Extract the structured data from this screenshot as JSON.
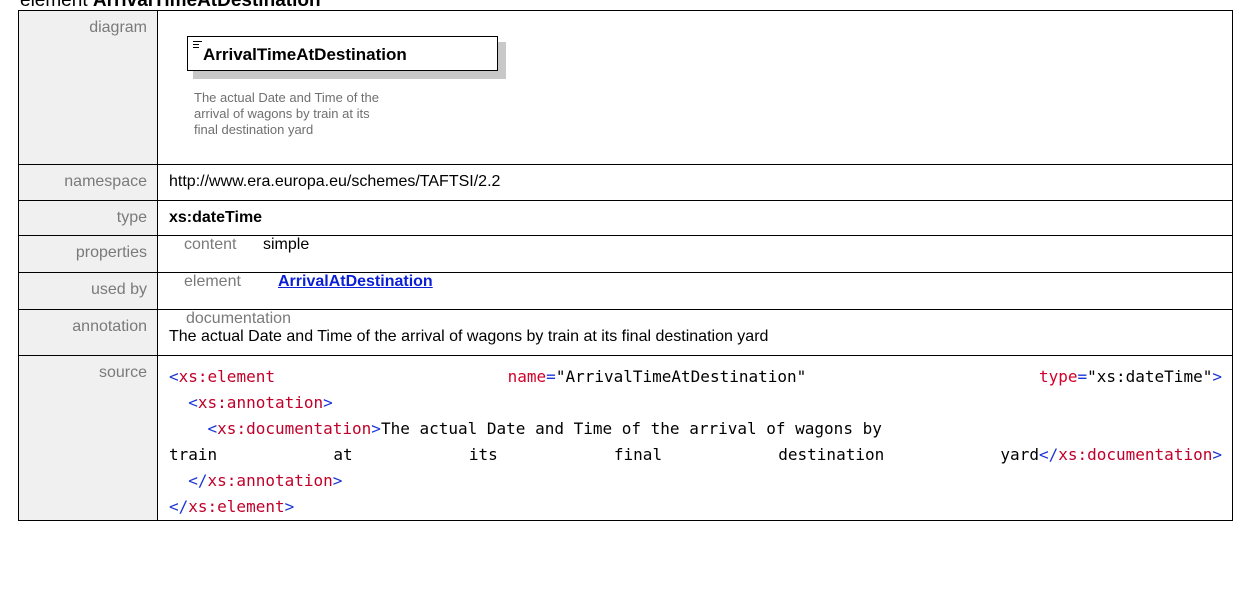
{
  "heading": {
    "prefix": "element ",
    "name": "ArrivalTimeAtDestination"
  },
  "labels": {
    "diagram": "diagram",
    "namespace": "namespace",
    "type": "type",
    "properties": "properties",
    "used_by": "used by",
    "annotation": "annotation",
    "source": "source"
  },
  "diagram": {
    "element_name": "ArrivalTimeAtDestination",
    "documentation_lines": [
      "The actual Date and Time of the",
      "arrival of wagons by train at its",
      "final destination yard"
    ]
  },
  "namespace": "http://www.era.europa.eu/schemes/TAFTSI/2.2",
  "type": "xs:dateTime",
  "properties": {
    "key": "content",
    "value": "simple"
  },
  "used_by": {
    "key": "element",
    "link": "ArrivalAtDestination"
  },
  "annotation": {
    "key": "documentation",
    "text": "The actual Date and Time of the arrival of wagons by train at its final destination yard"
  },
  "source": {
    "open_tag": "xs:element",
    "name_attr": "name",
    "name_value": "\"ArrivalTimeAtDestination\"",
    "type_attr": "type",
    "type_value": "\"xs:dateTime\"",
    "annotation_tag": "xs:annotation",
    "documentation_tag": "xs:documentation",
    "doc_text_1": "The actual Date and Time of the arrival of wagons by",
    "doc_words_2": [
      "train",
      "at",
      "its",
      "final",
      "destination",
      "yard"
    ]
  }
}
